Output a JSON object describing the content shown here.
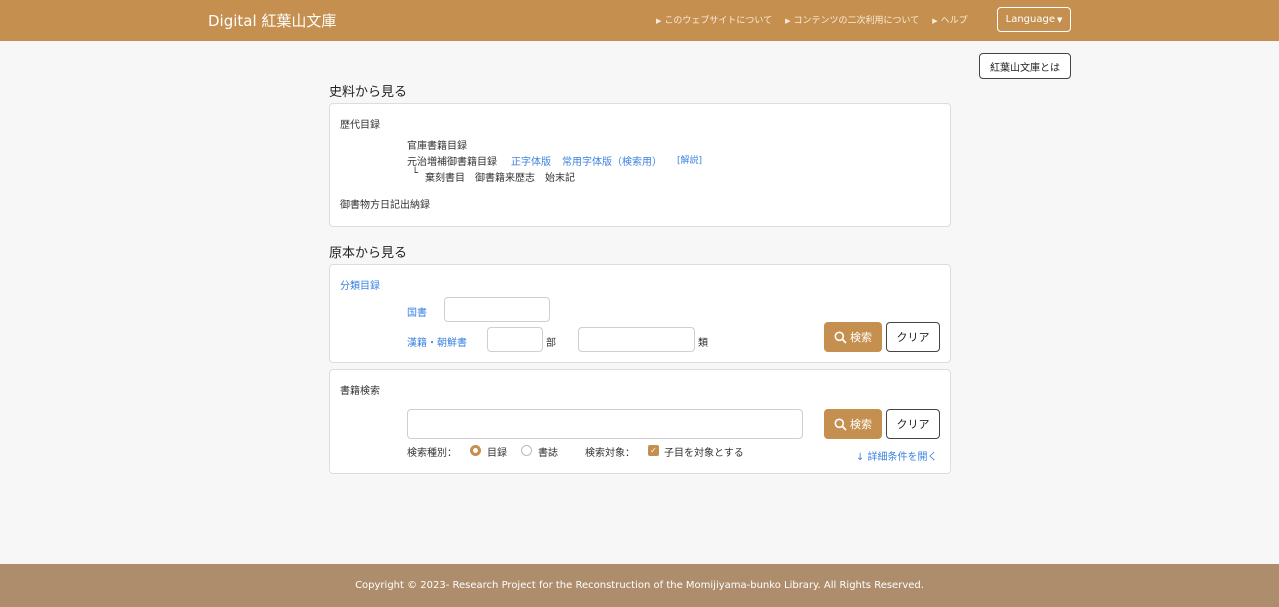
{
  "header": {
    "brand": "Digital 紅葉山文庫",
    "nav": [
      {
        "label": "このウェブサイトについて"
      },
      {
        "label": "コンテンツの二次利用について"
      },
      {
        "label": "ヘルプ"
      }
    ],
    "language_label": "Language"
  },
  "about_button": "紅葉山文庫とは",
  "sections": {
    "shiryo_title": "史料から見る",
    "genpon_title": "原本から見る"
  },
  "catalog": {
    "rekidai": "歴代目録",
    "kanko": "官庫書籍目録",
    "genji": "元治増補御書籍目録",
    "seiji_link": "正字体版",
    "joyo_link": "常用字体版（検索用）",
    "kaisetsu_link": "[解説]",
    "sub_prefix": "└",
    "sub_items": "棄刻書目　御書籍来歴志　始末記",
    "gosho": "御書物方日記出納録"
  },
  "classification": {
    "title": "分類目録",
    "kokusho": "国書",
    "kanseki": "漢籍・朝鮮書",
    "bu": "部",
    "rui": "類",
    "search_label": "検索",
    "clear_label": "クリア"
  },
  "book_search": {
    "title": "書籍検索",
    "search_label": "検索",
    "clear_label": "クリア",
    "type_label": "検索種別：",
    "type_options": [
      "目録",
      "書誌"
    ],
    "target_label": "検索対象：",
    "target_option": "子目を対象とする",
    "detail_link": "↓ 詳細条件を開く"
  },
  "footer": {
    "copyright": "Copyright © 2023- Research Project for the Reconstruction of the Momijiyama-bunko Library. All Rights Reserved."
  }
}
